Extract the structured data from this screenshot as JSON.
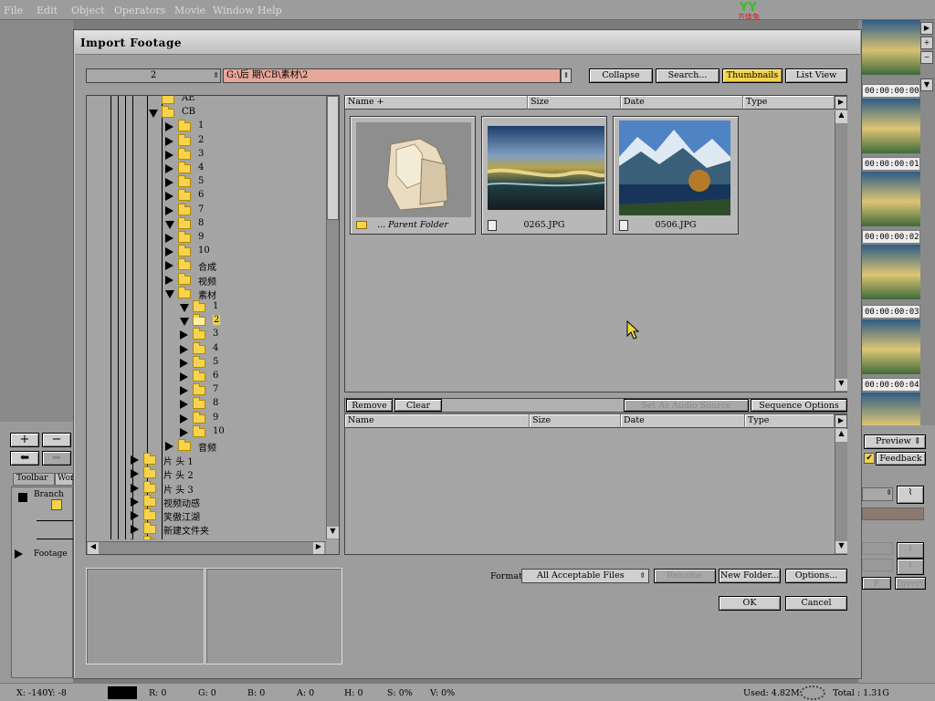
{
  "menu": [
    "File",
    "Edit",
    "Object",
    "Operators",
    "Movie",
    "Window",
    "Help"
  ],
  "logo_text": "方体兔",
  "dialog": {
    "title": "Import Footage",
    "drive_value": "2",
    "path_value": "G:\\后 期\\CB\\素材\\2",
    "buttons": {
      "collapse": "Collapse",
      "search": "Search...",
      "thumbnails": "Thumbnails",
      "list_view": "List View"
    },
    "columns": [
      "Name +",
      "Size",
      "Date",
      "Type"
    ],
    "columns2": [
      "Name",
      "Size",
      "Date",
      "Type"
    ],
    "thumbs": [
      {
        "caption": "... Parent Folder"
      },
      {
        "caption": "0265.JPG"
      },
      {
        "caption": "0506.JPG"
      }
    ],
    "queue_buttons": {
      "remove": "Remove",
      "clear": "Clear",
      "audio": "Set As Audio Source",
      "sequence": "Sequence Options"
    },
    "format_label": "Format",
    "format_value": "All Acceptable Files",
    "rename": "Rename",
    "new_folder": "New Folder...",
    "options": "Options...",
    "ok": "OK",
    "cancel": "Cancel",
    "tree": [
      {
        "label": "AE",
        "indent": 1,
        "exp": "none"
      },
      {
        "label": "CB",
        "indent": 1,
        "exp": "down"
      },
      {
        "label": "1",
        "indent": 2,
        "exp": "right"
      },
      {
        "label": "2",
        "indent": 2,
        "exp": "right"
      },
      {
        "label": "3",
        "indent": 2,
        "exp": "right"
      },
      {
        "label": "4",
        "indent": 2,
        "exp": "right"
      },
      {
        "label": "5",
        "indent": 2,
        "exp": "right"
      },
      {
        "label": "6",
        "indent": 2,
        "exp": "right"
      },
      {
        "label": "7",
        "indent": 2,
        "exp": "right"
      },
      {
        "label": "8",
        "indent": 2,
        "exp": "down"
      },
      {
        "label": "9",
        "indent": 2,
        "exp": "right"
      },
      {
        "label": "10",
        "indent": 2,
        "exp": "right"
      },
      {
        "label": "合成",
        "indent": 2,
        "exp": "right"
      },
      {
        "label": "视频",
        "indent": 2,
        "exp": "right"
      },
      {
        "label": "素材",
        "indent": 2,
        "exp": "down"
      },
      {
        "label": "1",
        "indent": 3,
        "exp": "down"
      },
      {
        "label": "2",
        "indent": 3,
        "exp": "down",
        "selected": true
      },
      {
        "label": "3",
        "indent": 3,
        "exp": "right"
      },
      {
        "label": "4",
        "indent": 3,
        "exp": "right"
      },
      {
        "label": "5",
        "indent": 3,
        "exp": "right"
      },
      {
        "label": "6",
        "indent": 3,
        "exp": "right"
      },
      {
        "label": "7",
        "indent": 3,
        "exp": "right"
      },
      {
        "label": "8",
        "indent": 3,
        "exp": "right"
      },
      {
        "label": "9",
        "indent": 3,
        "exp": "right"
      },
      {
        "label": "10",
        "indent": 3,
        "exp": "right"
      },
      {
        "label": "音频",
        "indent": 2,
        "exp": "right"
      },
      {
        "label": "片 头 1",
        "indent": 0,
        "exp": "right"
      },
      {
        "label": "片 头 2",
        "indent": 0,
        "exp": "right"
      },
      {
        "label": "片 头 3",
        "indent": 0,
        "exp": "right"
      },
      {
        "label": "视频动感",
        "indent": 0,
        "exp": "right"
      },
      {
        "label": "笑傲江湖",
        "indent": 0,
        "exp": "right"
      },
      {
        "label": "新建文件夹",
        "indent": 0,
        "exp": "right"
      },
      {
        "label": "音效",
        "indent": 0,
        "exp": "right"
      }
    ]
  },
  "left_panel": {
    "tab_toolbar": "Toolbar",
    "tab_works": "Wor",
    "branch": "Branch",
    "footage": "Footage"
  },
  "right_panel": {
    "timecodes": [
      "00:00:00:00",
      "00:00:00:01",
      "00:00:00:02",
      "00:00:00:03",
      "00:00:00:04"
    ],
    "preview": "Preview",
    "feedback": "Feedback",
    "invert": "Invert"
  },
  "status": {
    "x": "X: -140Y:   -8",
    "r": "R: 0",
    "g": "G: 0",
    "b": "B: 0",
    "a": "A: 0",
    "h": "H: 0",
    "s": "S: 0%",
    "v": "V: 0%",
    "used": "Used: 4.82M",
    "total": "Total : 1.31G"
  },
  "colors": {
    "path_bg": "#e8a79a",
    "accent": "#f2d34a"
  }
}
